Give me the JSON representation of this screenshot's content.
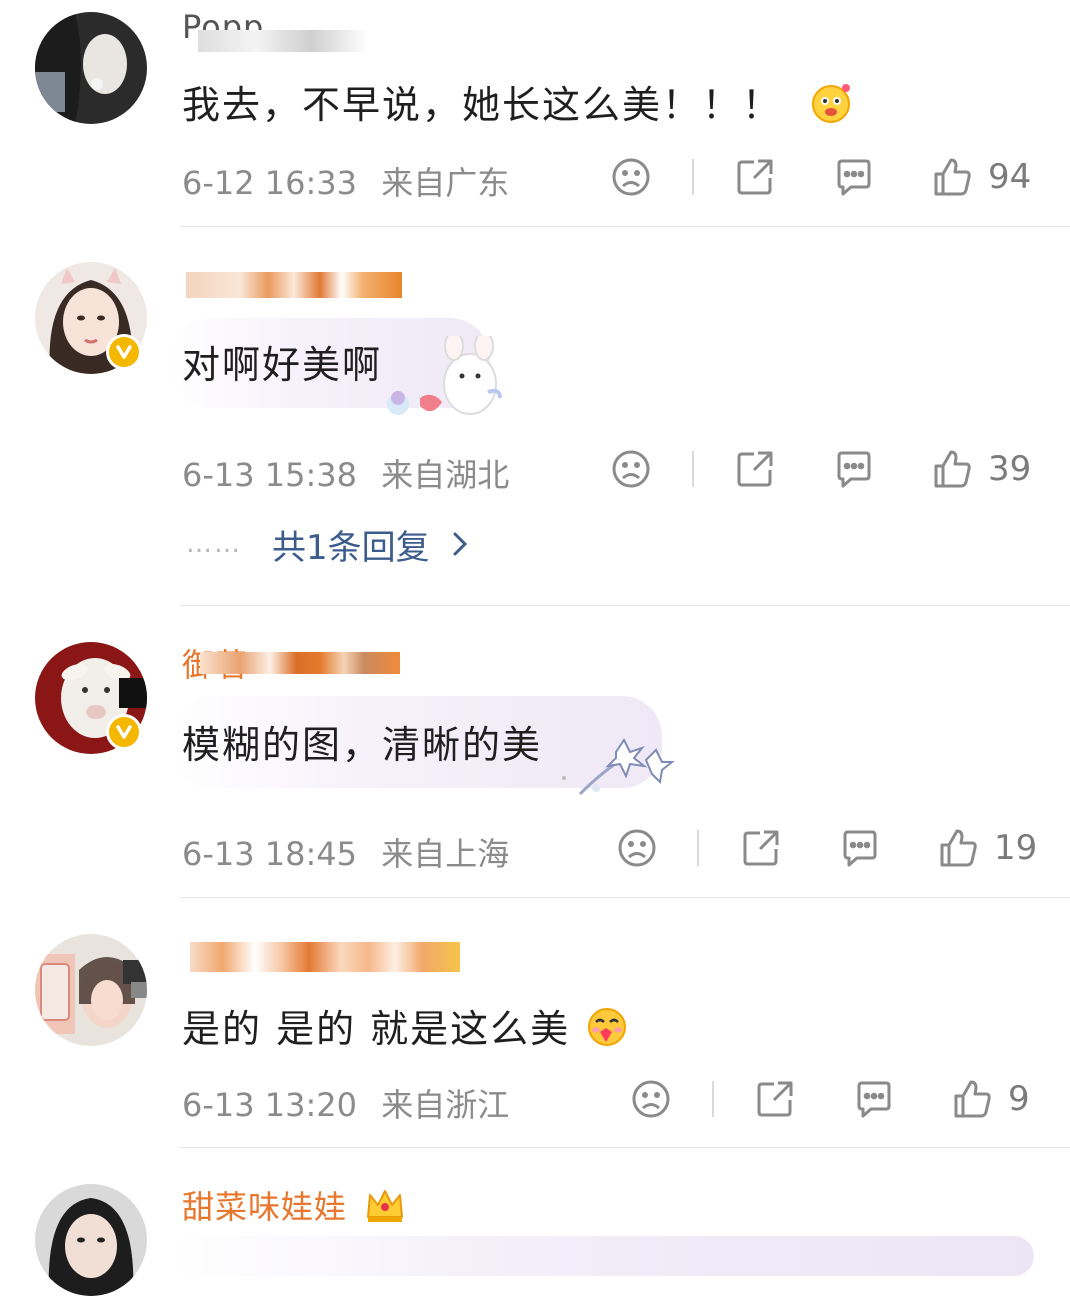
{
  "comments": [
    {
      "username": "Popp",
      "text": "我去，不早说，她长这么美！！！",
      "time": "6-12 16:33",
      "location": "来自广东",
      "likes": "94",
      "verified": false,
      "emoji": "laughing-face-emoji"
    },
    {
      "username": "",
      "text": "对啊好美啊",
      "time": "6-13 15:38",
      "location": "来自湖北",
      "likes": "39",
      "verified": true,
      "replies": "共1条回复",
      "reply_dots": "……"
    },
    {
      "username": "御茗",
      "text": "模糊的图，清晰的美",
      "time": "6-13 18:45",
      "location": "来自上海",
      "likes": "19",
      "verified": true
    },
    {
      "username": "",
      "text": "是的  是的  就是这么美",
      "time": "6-13 13:20",
      "location": "来自浙江",
      "likes": "9",
      "verified": false,
      "emoji": "heart-eyes-face-emoji"
    },
    {
      "username": "甜菜味娃娃",
      "verified": false,
      "badge": "crown-icon"
    }
  ],
  "colors": {
    "username": "#e8772d",
    "meta": "#8b8b8b",
    "reply_link": "#3b5c8c",
    "verified_badge": "#f5b800"
  }
}
